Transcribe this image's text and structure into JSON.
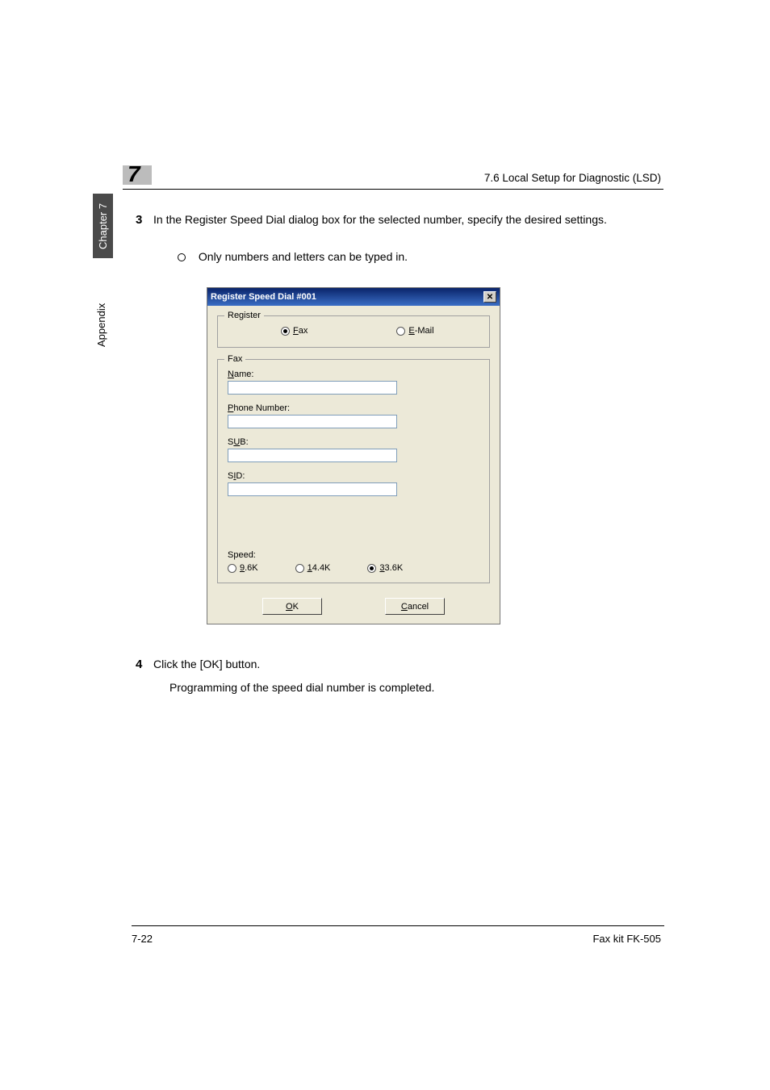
{
  "header": {
    "section_title": "7.6 Local Setup for Diagnostic (LSD)",
    "chapter_number": "7",
    "side_chapter": "Chapter 7",
    "side_appendix": "Appendix"
  },
  "steps": {
    "s3_num": "3",
    "s3_text": "In the Register Speed Dial dialog box for the selected number, specify the desired settings.",
    "s3_bullet": "Only numbers and letters can be typed in.",
    "s4_num": "4",
    "s4_text": "Click the [OK] button.",
    "s4_text2": "Programming of the speed dial number is completed."
  },
  "dialog": {
    "title": "Register Speed Dial #001",
    "close_glyph": "✕",
    "register_group": "Register",
    "radio_fax": "Fax",
    "radio_email": "E-Mail",
    "fax_group": "Fax",
    "label_name": "Name:",
    "label_phone": "Phone Number:",
    "label_sub": "SUB:",
    "label_sid": "SID:",
    "label_speed": "Speed:",
    "speed_96": "9.6K",
    "speed_144": "14.4K",
    "speed_336": "33.6K",
    "btn_ok": "OK",
    "btn_cancel": "Cancel",
    "val_name": "",
    "val_phone": "",
    "val_sub": "",
    "val_sid": ""
  },
  "footer": {
    "page": "7-22",
    "product": "Fax kit FK-505"
  }
}
